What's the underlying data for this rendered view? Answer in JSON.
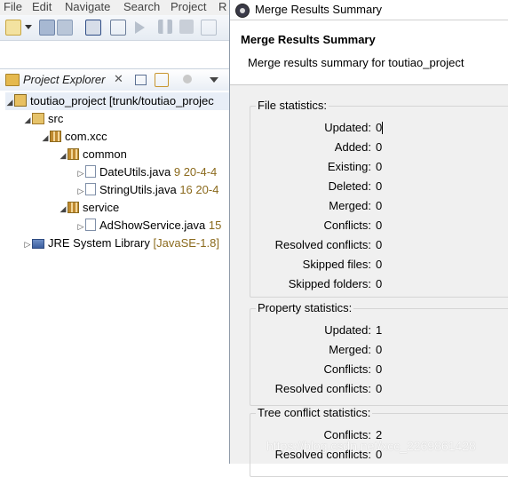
{
  "menu": {
    "file": "File",
    "edit": "Edit",
    "navigate": "Navigate",
    "search": "Search",
    "project": "Project",
    "run_partial": "R"
  },
  "explorer": {
    "tab_label": "Project Explorer",
    "close_glyph": "✕",
    "tree": {
      "project": {
        "name": "toutiao_project",
        "decoration": "[trunk/toutiao_projec"
      },
      "src": "src",
      "package": "com.xcc",
      "common": "common",
      "date_utils": {
        "name": "DateUtils.java",
        "rev": "9",
        "date": "20-4-4"
      },
      "string_utils": {
        "name": "StringUtils.java",
        "rev": "16",
        "date": "20-4"
      },
      "service": "service",
      "ad_show": {
        "name": "AdShowService.java",
        "rev": "15"
      },
      "jre": {
        "name": "JRE System Library",
        "decoration": "[JavaSE-1.8]"
      }
    }
  },
  "dialog": {
    "window_title": "Merge Results Summary",
    "heading": "Merge Results Summary",
    "subtitle": "Merge results summary for toutiao_project",
    "file_stats": {
      "title": "File statistics:",
      "rows": [
        {
          "label": "Updated:",
          "value": "0"
        },
        {
          "label": "Added:",
          "value": "0"
        },
        {
          "label": "Existing:",
          "value": "0"
        },
        {
          "label": "Deleted:",
          "value": "0"
        },
        {
          "label": "Merged:",
          "value": "0"
        },
        {
          "label": "Conflicts:",
          "value": "0"
        },
        {
          "label": "Resolved conflicts:",
          "value": "0"
        },
        {
          "label": "Skipped files:",
          "value": "0"
        },
        {
          "label": "Skipped folders:",
          "value": "0"
        }
      ]
    },
    "property_stats": {
      "title": "Property statistics:",
      "rows": [
        {
          "label": "Updated:",
          "value": "1"
        },
        {
          "label": "Merged:",
          "value": "0"
        },
        {
          "label": "Conflicts:",
          "value": "0"
        },
        {
          "label": "Resolved conflicts:",
          "value": "0"
        }
      ]
    },
    "tree_conflict_stats": {
      "title": "Tree conflict statistics:",
      "rows": [
        {
          "label": "Conflicts:",
          "value": "2"
        },
        {
          "label": "Resolved conflicts:",
          "value": "0"
        }
      ]
    }
  },
  "watermark": "https://blog.csdn.net/xcc_2269861428",
  "colors": {
    "folder": "#d9a441",
    "package": "#b07a2a",
    "java_file": "#5b7fb8",
    "decoration": "#8b6a1d"
  }
}
